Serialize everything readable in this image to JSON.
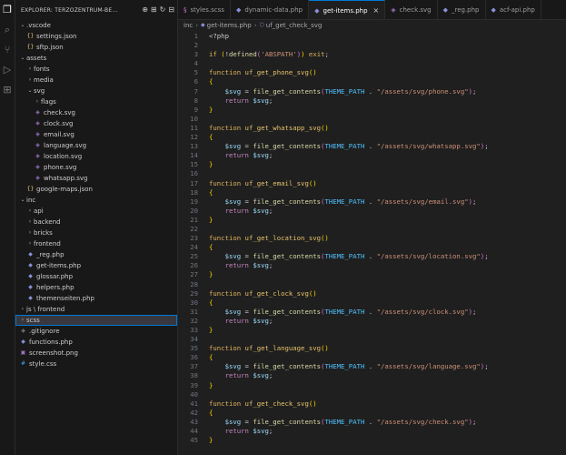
{
  "explorer": {
    "title": "EXPLORER: TERZOZENTRUM-BE...",
    "items": [
      {
        "label": ".vscode",
        "type": "folder",
        "open": true,
        "depth": 0
      },
      {
        "label": "settings.json",
        "type": "json",
        "depth": 1
      },
      {
        "label": "sftp.json",
        "type": "json",
        "depth": 1
      },
      {
        "label": "assets",
        "type": "folder",
        "open": true,
        "depth": 0
      },
      {
        "label": "fonts",
        "type": "folder",
        "open": false,
        "depth": 1
      },
      {
        "label": "media",
        "type": "folder",
        "open": false,
        "depth": 1
      },
      {
        "label": "svg",
        "type": "folder",
        "open": true,
        "depth": 1
      },
      {
        "label": "flags",
        "type": "folder",
        "open": false,
        "depth": 2
      },
      {
        "label": "check.svg",
        "type": "svg",
        "depth": 2
      },
      {
        "label": "clock.svg",
        "type": "svg",
        "depth": 2
      },
      {
        "label": "email.svg",
        "type": "svg",
        "depth": 2
      },
      {
        "label": "language.svg",
        "type": "svg",
        "depth": 2
      },
      {
        "label": "location.svg",
        "type": "svg",
        "depth": 2
      },
      {
        "label": "phone.svg",
        "type": "svg",
        "depth": 2
      },
      {
        "label": "whatsapp.svg",
        "type": "svg",
        "depth": 2
      },
      {
        "label": "google-maps.json",
        "type": "json",
        "depth": 1
      },
      {
        "label": "inc",
        "type": "folder",
        "open": true,
        "depth": 0
      },
      {
        "label": "api",
        "type": "folder",
        "open": false,
        "depth": 1
      },
      {
        "label": "backend",
        "type": "folder",
        "open": false,
        "depth": 1
      },
      {
        "label": "bricks",
        "type": "folder",
        "open": false,
        "depth": 1
      },
      {
        "label": "frontend",
        "type": "folder",
        "open": false,
        "depth": 1
      },
      {
        "label": "_reg.php",
        "type": "php",
        "depth": 1
      },
      {
        "label": "get-items.php",
        "type": "php",
        "depth": 1
      },
      {
        "label": "glossar.php",
        "type": "php",
        "depth": 1
      },
      {
        "label": "helpers.php",
        "type": "php",
        "depth": 1
      },
      {
        "label": "themenseiten.php",
        "type": "php",
        "depth": 1
      },
      {
        "label": "js \\ frontend",
        "type": "folder",
        "open": false,
        "depth": 0
      },
      {
        "label": "scss",
        "type": "folder",
        "open": false,
        "depth": 0,
        "selected": true
      },
      {
        "label": ".gitignore",
        "type": "ignore",
        "depth": 0
      },
      {
        "label": "functions.php",
        "type": "php",
        "depth": 0
      },
      {
        "label": "screenshot.png",
        "type": "png",
        "depth": 0
      },
      {
        "label": "style.css",
        "type": "css",
        "depth": 0
      }
    ]
  },
  "tabs": [
    {
      "label": "styles.scss",
      "icon": "scss-file-icon",
      "color": "#d670d6"
    },
    {
      "label": "dynamic-data.php",
      "icon": "php-file-icon",
      "color": "#8a8fd9"
    },
    {
      "label": "get-items.php",
      "icon": "php-file-icon",
      "color": "#8a8fd9",
      "active": true,
      "close": "×"
    },
    {
      "label": "check.svg",
      "icon": "svg-file-icon",
      "color": "#a074c4"
    },
    {
      "label": "_reg.php",
      "icon": "php-file-icon",
      "color": "#8a8fd9"
    },
    {
      "label": "acf-api.php",
      "icon": "php-file-icon",
      "color": "#8a8fd9"
    }
  ],
  "breadcrumb": {
    "folder": "inc",
    "file": "get-items.php",
    "symbol": "uf_get_check_svg"
  },
  "editor": {
    "current_line": 46,
    "functions": [
      {
        "name": "uf_get_phone_svg",
        "path": "/assets/svg/phone.svg"
      },
      {
        "name": "uf_get_whatsapp_svg",
        "path": "/assets/svg/whatsapp.svg"
      },
      {
        "name": "uf_get_email_svg",
        "path": "/assets/svg/email.svg"
      },
      {
        "name": "uf_get_location_svg",
        "path": "/assets/svg/location.svg"
      },
      {
        "name": "uf_get_clock_svg",
        "path": "/assets/svg/clock.svg"
      },
      {
        "name": "uf_get_language_svg",
        "path": "/assets/svg/language.svg"
      },
      {
        "name": "uf_get_check_svg",
        "path": "/assets/svg/check.svg"
      }
    ],
    "open_tag": "<?php",
    "guard": "if (!defined('ABSPATH')) exit;"
  },
  "colors": {
    "selection_border": "#0078d4",
    "active_tab_border": "#0078d4"
  }
}
